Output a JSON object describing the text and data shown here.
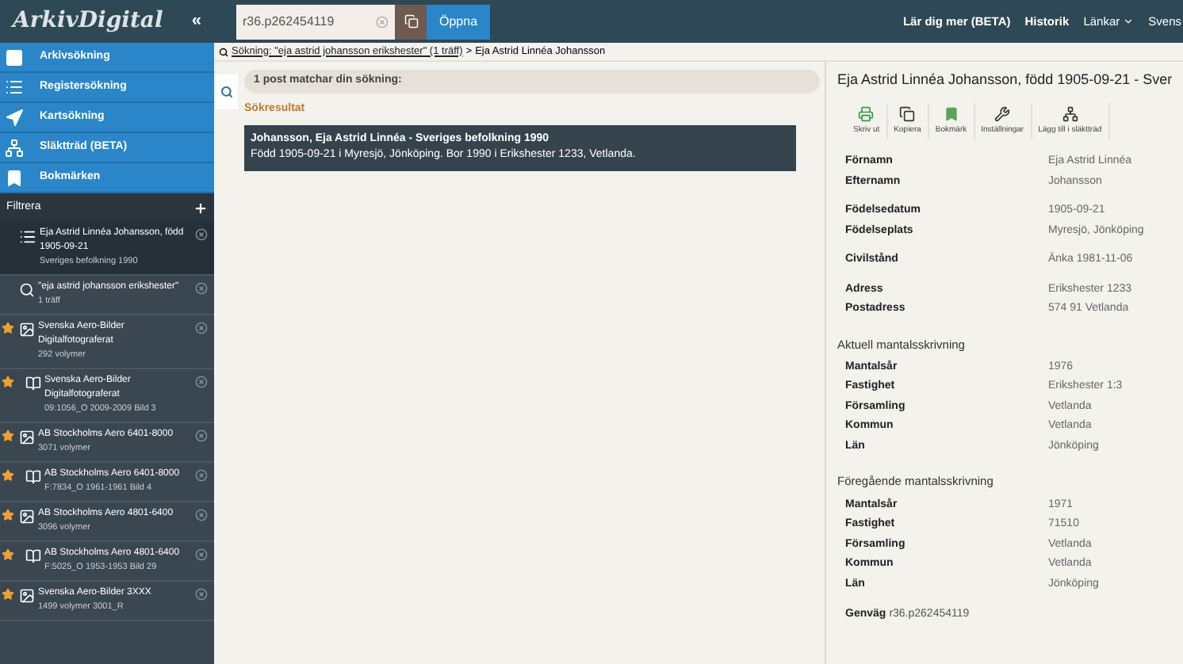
{
  "topbar": {
    "logo": "ArkivDigital",
    "collapse": "«",
    "search_value": "r36.p262454119",
    "open_button": "Öppna",
    "links": [
      {
        "label": "Lär dig mer (BETA)",
        "kind": "bold"
      },
      {
        "label": "Historik",
        "kind": "bold"
      },
      {
        "label": "Länkar",
        "kind": "menu"
      },
      {
        "label": "Svens",
        "kind": "plain"
      }
    ]
  },
  "sidebar": {
    "nav": [
      {
        "label": "Arkivsökning"
      },
      {
        "label": "Registersökning"
      },
      {
        "label": "Kartsökning"
      },
      {
        "label": "Släktträd (BETA)"
      },
      {
        "label": "Bokmärken"
      }
    ],
    "filter_label": "Filtrera",
    "items": [
      {
        "kind": "list",
        "starred": false,
        "selected": true,
        "title": "Eja Astrid Linnéa Johansson, född 1905-09-21",
        "subtitle": "Sveriges befolkning 1990"
      },
      {
        "kind": "search",
        "starred": false,
        "selected": false,
        "title": "\"eja astrid johansson erikshester\"",
        "subtitle": "1 träff"
      },
      {
        "kind": "archive",
        "starred": true,
        "selected": false,
        "title": "Svenska Aero-Bilder Digitalfotograferat",
        "subtitle": "292 volymer"
      },
      {
        "kind": "volume",
        "starred": true,
        "selected": false,
        "title": "Svenska Aero-Bilder Digitalfotograferat",
        "subtitle": "09:1056_O 2009-2009  Bild 3"
      },
      {
        "kind": "archive",
        "starred": true,
        "selected": false,
        "title": "AB Stockholms Aero 6401-8000",
        "subtitle": "3071 volymer"
      },
      {
        "kind": "volume",
        "starred": true,
        "selected": false,
        "title": "AB Stockholms Aero 6401-8000",
        "subtitle": "F:7834_O 1961-1961  Bild 4"
      },
      {
        "kind": "archive",
        "starred": true,
        "selected": false,
        "title": "AB Stockholms Aero 4801-6400",
        "subtitle": "3096 volymer"
      },
      {
        "kind": "volume",
        "starred": true,
        "selected": false,
        "title": "AB Stockholms Aero 4801-6400",
        "subtitle": "F:5025_O 1953-1953  Bild 29"
      },
      {
        "kind": "archive",
        "starred": true,
        "selected": false,
        "title": "Svenska Aero-Bilder 3XXX",
        "subtitle": "1499 volymer  3001_R"
      }
    ]
  },
  "breadcrumb": {
    "link": "Sökning: \"eja astrid johansson erikshester\" (1 träff)",
    "separator": ">",
    "current": "Eja Astrid Linnéa Johansson"
  },
  "results": {
    "summary": "1 post matchar din sökning:",
    "heading": "Sökresultat",
    "rows": [
      {
        "selected": true,
        "title": "Johansson, Eja Astrid Linnéa - Sveriges befolkning 1990",
        "detail": "Född 1905-09-21 i Myresjö, Jönköping. Bor 1990 i Erikshester 1233, Vetlanda."
      }
    ]
  },
  "detail": {
    "title": "Eja Astrid Linnéa Johansson, född 1905-09-21 - Sver",
    "toolbar": [
      {
        "label": "Skriv ut"
      },
      {
        "label": "Kopiera"
      },
      {
        "label": "Bokmärk"
      },
      {
        "label": "Inställningar"
      },
      {
        "label": "Lägg till i släktträd"
      }
    ],
    "groups": [
      {
        "rows": [
          {
            "label": "Förnamn",
            "value": "Eja Astrid Linnéa"
          },
          {
            "label": "Efternamn",
            "value": "Johansson"
          }
        ]
      },
      {
        "rows": [
          {
            "label": "Födelsedatum",
            "value": "1905-09-21"
          },
          {
            "label": "Födelseplats",
            "value": "Myresjö, Jönköping"
          }
        ]
      },
      {
        "rows": [
          {
            "label": "Civilstånd",
            "value": "Änka 1981-11-06"
          }
        ]
      },
      {
        "rows": [
          {
            "label": "Adress",
            "value": "Erikshester 1233"
          },
          {
            "label": "Postadress",
            "value": "574 91 Vetlanda"
          }
        ]
      },
      {
        "heading": "Aktuell mantalsskrivning",
        "rows": [
          {
            "label": "Mantalsår",
            "value": "1976"
          },
          {
            "label": "Fastighet",
            "value": "Erikshester 1:3"
          },
          {
            "label": "Församling",
            "value": "Vetlanda"
          },
          {
            "label": "Kommun",
            "value": "Vetlanda"
          },
          {
            "label": "Län",
            "value": "Jönköping"
          }
        ]
      },
      {
        "heading": "Föregående mantalsskrivning",
        "rows": [
          {
            "label": "Mantalsår",
            "value": "1971"
          },
          {
            "label": "Fastighet",
            "value": "71510"
          },
          {
            "label": "Församling",
            "value": "Vetlanda"
          },
          {
            "label": "Kommun",
            "value": "Vetlanda"
          },
          {
            "label": "Län",
            "value": "Jönköping"
          }
        ]
      }
    ],
    "shortcut_label": "Genväg",
    "shortcut_value": "r36.p262454119"
  }
}
